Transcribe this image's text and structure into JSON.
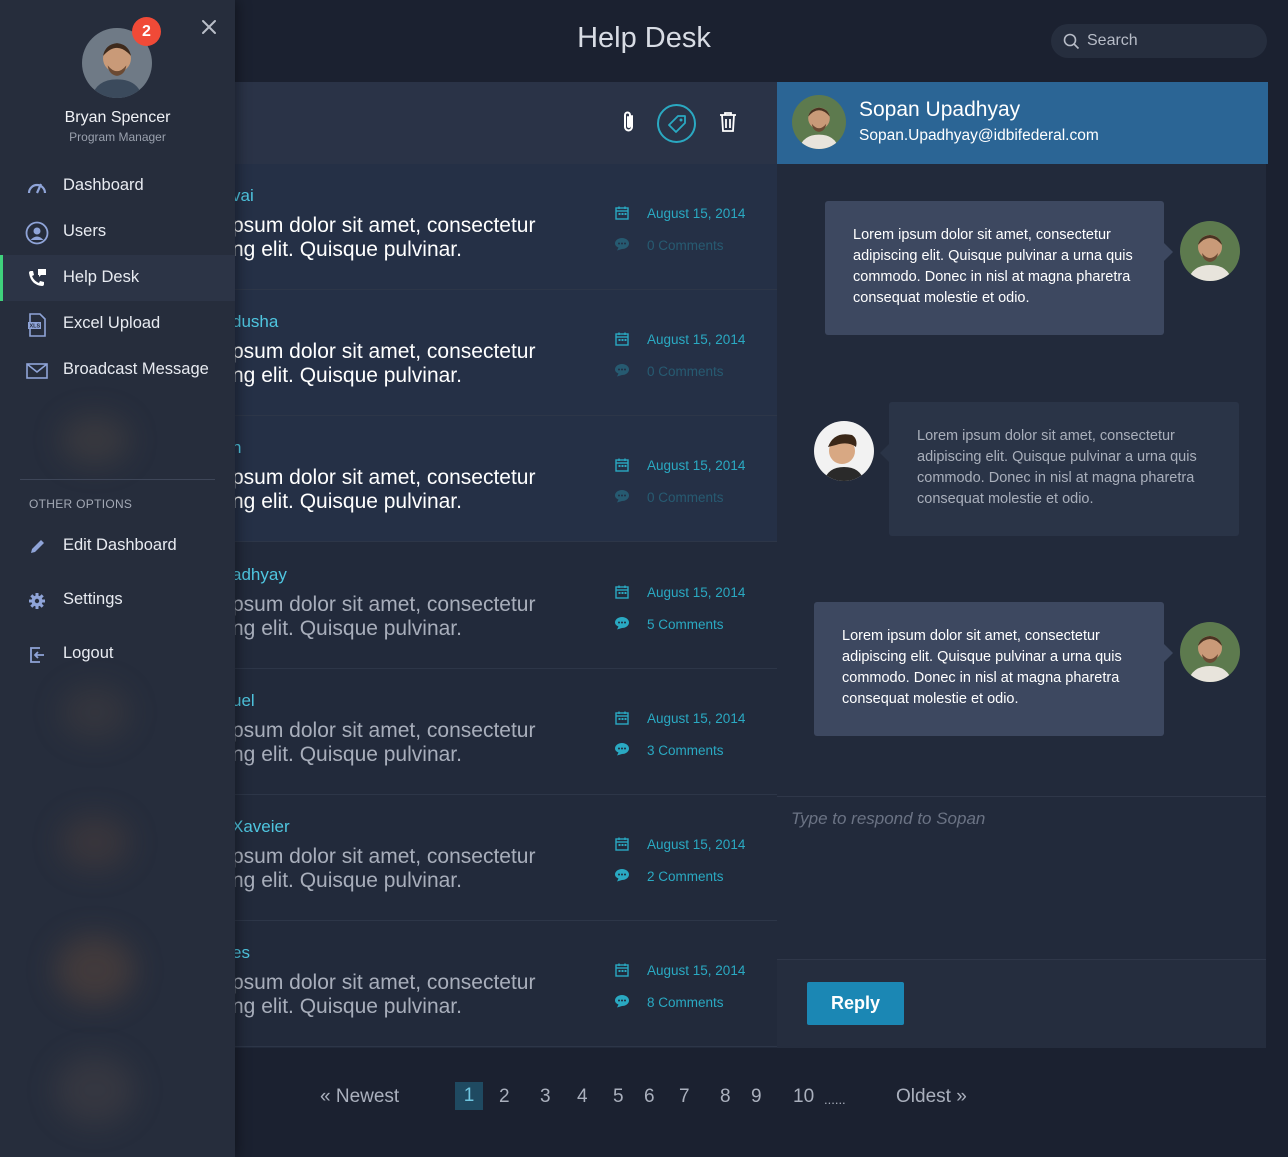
{
  "header": {
    "title": "Help Desk",
    "search_placeholder": "Search"
  },
  "sidebar": {
    "profile": {
      "name": "Bryan Spencer",
      "role": "Program Manager",
      "badge": "2"
    },
    "nav": [
      {
        "label": "Dashboard",
        "icon": "gauge-icon"
      },
      {
        "label": "Users",
        "icon": "user-circle-icon"
      },
      {
        "label": "Help Desk",
        "icon": "phone-chat-icon",
        "active": true
      },
      {
        "label": "Excel Upload",
        "icon": "xls-file-icon"
      },
      {
        "label": "Broadcast Message",
        "icon": "envelope-icon"
      }
    ],
    "other_label": "OTHER OPTIONS",
    "other": [
      {
        "label": "Edit Dashboard",
        "icon": "pencil-icon"
      },
      {
        "label": "Settings",
        "icon": "gear-icon"
      },
      {
        "label": "Logout",
        "icon": "logout-icon"
      }
    ]
  },
  "tickets": [
    {
      "name": "vai",
      "body_line1": "psum dolor sit amet, consectetur",
      "body_line2": "ng elit. Quisque pulvinar.",
      "date": "August 15, 2014",
      "comments": "0 Comments",
      "unread": true
    },
    {
      "name": "dusha",
      "body_line1": "psum dolor sit amet, consectetur",
      "body_line2": "ng elit. Quisque pulvinar.",
      "date": "August 15, 2014",
      "comments": "0 Comments",
      "unread": true
    },
    {
      "name": "n",
      "body_line1": "psum dolor sit amet, consectetur",
      "body_line2": "ng elit. Quisque pulvinar.",
      "date": "August 15, 2014",
      "comments": "0 Comments",
      "unread": true
    },
    {
      "name": "adhyay",
      "body_line1": "psum dolor sit amet, consectetur",
      "body_line2": "ng elit. Quisque pulvinar.",
      "date": "August 15, 2014",
      "comments": "5 Comments",
      "unread": false
    },
    {
      "name": "uel",
      "body_line1": "psum dolor sit amet, consectetur",
      "body_line2": "ng elit. Quisque pulvinar.",
      "date": "August 15, 2014",
      "comments": "3 Comments",
      "unread": false
    },
    {
      "name": "Xaveier",
      "body_line1": "psum dolor sit amet, consectetur",
      "body_line2": "ng elit. Quisque pulvinar.",
      "date": "August 15, 2014",
      "comments": "2 Comments",
      "unread": false
    },
    {
      "name": "es",
      "body_line1": "psum dolor sit amet, consectetur",
      "body_line2": "ng elit. Quisque pulvinar.",
      "date": "August 15, 2014",
      "comments": "8 Comments",
      "unread": false
    }
  ],
  "pagination": {
    "newest": "« Newest",
    "pages": [
      "1",
      "2",
      "3",
      "4",
      "5",
      "6",
      "7",
      "8",
      "9",
      "10"
    ],
    "ellipsis": "......",
    "oldest": "Oldest  »",
    "current": "1"
  },
  "conversation": {
    "contact_name": "Sopan Upadhyay",
    "contact_email": "Sopan.Upadhyay@idbifederal.com",
    "messages": [
      {
        "from": "me",
        "text": "Lorem ipsum dolor sit amet, consectetur adipiscing elit. Quisque pulvinar a urna quis commodo. Donec in nisl at magna pharetra consequat molestie et odio."
      },
      {
        "from": "them",
        "text": "Lorem ipsum dolor sit amet, consectetur adipiscing elit. Quisque pulvinar a urna quis commodo. Donec in nisl at magna pharetra consequat molestie et odio."
      },
      {
        "from": "me",
        "text": "Lorem ipsum dolor sit amet, consectetur adipiscing elit. Quisque pulvinar a urna quis commodo. Donec in nisl at magna pharetra consequat molestie et odio."
      }
    ],
    "reply_placeholder": "Type to respond to Sopan",
    "reply_button": "Reply"
  },
  "colors": {
    "accent": "#2aa9c2",
    "active_nav": "#3fd17c",
    "badge": "#f04a37",
    "header_blue": "#2b6595",
    "reply_button": "#1b87b4"
  }
}
